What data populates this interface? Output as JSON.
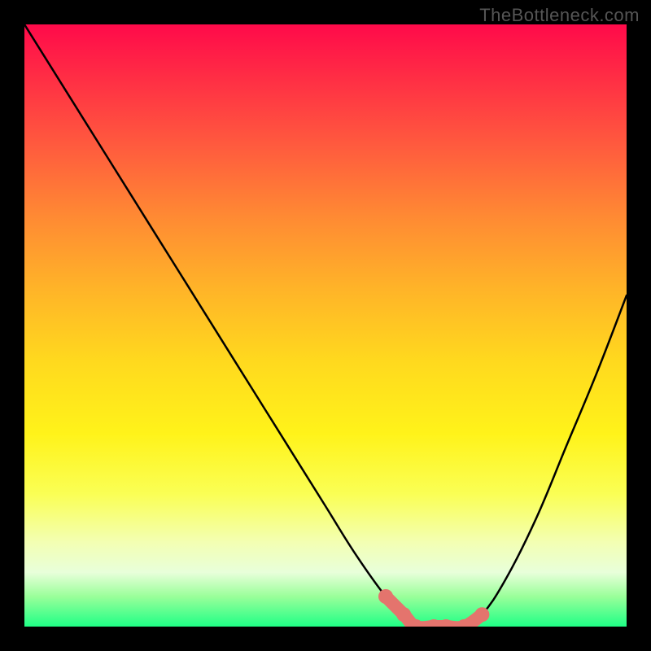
{
  "watermark": "TheBottleneck.com",
  "chart_data": {
    "type": "line",
    "title": "",
    "xlabel": "",
    "ylabel": "",
    "xlim": [
      0,
      100
    ],
    "ylim": [
      0,
      100
    ],
    "series": [
      {
        "name": "curve",
        "x": [
          0,
          5,
          10,
          15,
          20,
          25,
          30,
          35,
          40,
          45,
          50,
          55,
          60,
          63,
          65,
          68,
          70,
          73,
          76,
          80,
          85,
          90,
          95,
          100
        ],
        "values": [
          100,
          92,
          84,
          76,
          68,
          60,
          52,
          44,
          36,
          28,
          20,
          12,
          5,
          2,
          0,
          0,
          0,
          0,
          2,
          8,
          18,
          30,
          42,
          55
        ]
      }
    ],
    "highlight": {
      "name": "valley-markers",
      "x": [
        60,
        63,
        65,
        68,
        70,
        73,
        76
      ],
      "values": [
        5,
        2,
        0,
        0,
        0,
        0,
        2
      ]
    },
    "gradient_stops": [
      {
        "pos": 0,
        "color": "#ff0a4a"
      },
      {
        "pos": 8,
        "color": "#ff2a45"
      },
      {
        "pos": 20,
        "color": "#ff5a3e"
      },
      {
        "pos": 32,
        "color": "#ff8a33"
      },
      {
        "pos": 44,
        "color": "#ffb428"
      },
      {
        "pos": 56,
        "color": "#ffd91e"
      },
      {
        "pos": 68,
        "color": "#fff31a"
      },
      {
        "pos": 78,
        "color": "#faff55"
      },
      {
        "pos": 86,
        "color": "#f3ffb3"
      },
      {
        "pos": 91,
        "color": "#e8ffda"
      },
      {
        "pos": 95,
        "color": "#9aff9a"
      },
      {
        "pos": 100,
        "color": "#1fff86"
      }
    ],
    "colors": {
      "curve": "#000000",
      "highlight": "#e4746d",
      "background_frame": "#000000"
    }
  }
}
